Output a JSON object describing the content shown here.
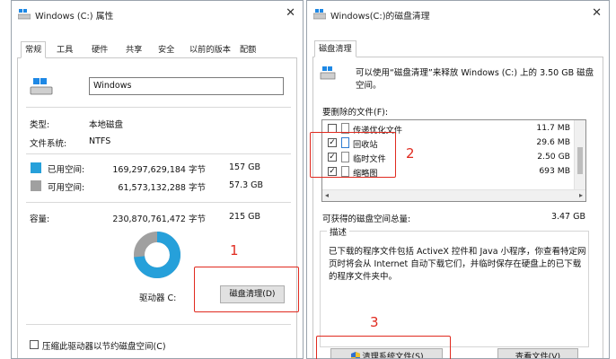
{
  "props": {
    "title": "Windows (C:) 属性",
    "tabs": [
      "常规",
      "工具",
      "硬件",
      "共享",
      "安全",
      "以前的版本",
      "配额"
    ],
    "drive_name": "Windows",
    "type_label": "类型:",
    "type_value": "本地磁盘",
    "fs_label": "文件系统:",
    "fs_value": "NTFS",
    "used": {
      "label": "已用空间:",
      "bytes": "169,297,629,184 字节",
      "size": "157 GB",
      "color": "#26a0da"
    },
    "free": {
      "label": "可用空间:",
      "bytes": "61,573,132,288 字节",
      "size": "57.3 GB",
      "color": "#a0a0a0"
    },
    "capacity": {
      "label": "容量:",
      "bytes": "230,870,761,472 字节",
      "size": "215 GB"
    },
    "used_fraction": 0.733,
    "drive_label": "驱动器 C:",
    "cleanup_button": "磁盘清理(D)",
    "compress_label": "压缩此驱动器以节约磁盘空间(C)"
  },
  "cleanup": {
    "title": "Windows(C:)的磁盘清理",
    "tab": "磁盘清理",
    "description": "可以使用“磁盘清理”来释放 Windows (C:) 上的 3.50 GB 磁盘空间。",
    "files_label": "要删除的文件(F):",
    "items": [
      {
        "name": "传递优化文件",
        "size": "11.7 MB",
        "checked": false
      },
      {
        "name": "回收站",
        "size": "29.6 MB",
        "checked": true
      },
      {
        "name": "临时文件",
        "size": "2.50 GB",
        "checked": true
      },
      {
        "name": "缩略图",
        "size": "693 MB",
        "checked": true
      }
    ],
    "total_label": "可获得的磁盘空间总量:",
    "total_value": "3.47 GB",
    "desc_group_label": "描述",
    "desc_text_1": "已下载的程序文件包括 ActiveX 控件和 Java 小程序，你查看特定网",
    "desc_text_2": "页时将会从 Internet 自动下载它们，并临时保存在硬盘上的已下载",
    "desc_text_3": "的程序文件夹中。",
    "clean_system_button": "清理系统文件(S)",
    "view_files_button": "查看文件(V)"
  },
  "annotations": [
    "1",
    "2",
    "3"
  ]
}
